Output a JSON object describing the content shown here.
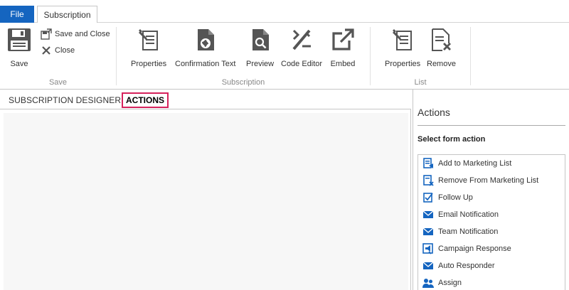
{
  "tabs": {
    "file": "File",
    "subscription": "Subscription"
  },
  "ribbon": {
    "save_group": {
      "label": "Save",
      "save": "Save",
      "save_and_close": "Save and Close",
      "close": "Close"
    },
    "subscription_group": {
      "label": "Subscription",
      "properties": "Properties",
      "confirmation_text": "Confirmation Text",
      "preview": "Preview",
      "code_editor": "Code Editor",
      "embed": "Embed"
    },
    "list_group": {
      "label": "List",
      "properties": "Properties",
      "remove": "Remove"
    }
  },
  "designer_tabs": {
    "designer": "SUBSCRIPTION DESIGNER",
    "actions": "ACTIONS"
  },
  "panel": {
    "title": "Actions",
    "subtitle": "Select form action",
    "actions": [
      {
        "label": "Add to Marketing List",
        "icon": "add-to-list-icon"
      },
      {
        "label": "Remove From Marketing List",
        "icon": "remove-from-list-icon"
      },
      {
        "label": "Follow Up",
        "icon": "checkbox-icon"
      },
      {
        "label": "Email Notification",
        "icon": "envelope-icon"
      },
      {
        "label": "Team Notification",
        "icon": "envelope-icon"
      },
      {
        "label": "Campaign Response",
        "icon": "campaign-response-icon"
      },
      {
        "label": "Auto Responder",
        "icon": "envelope-icon"
      },
      {
        "label": "Assign",
        "icon": "users-icon"
      }
    ]
  },
  "colors": {
    "file_tab": "#1565c0",
    "highlight": "#d6225c",
    "icon_dark": "#555555",
    "icon_blue": "#1565c0"
  }
}
